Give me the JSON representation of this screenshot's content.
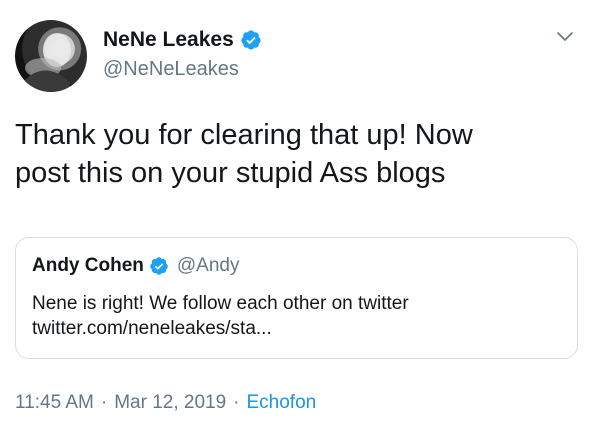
{
  "author": {
    "display_name": "NeNe Leakes",
    "handle": "@NeNeLeakes",
    "verified": true
  },
  "tweet": {
    "text": "Thank you for clearing that up! Now\npost this on your stupid Ass blogs",
    "time": "11:45 AM",
    "separator": "·",
    "date": "Mar 12, 2019",
    "source": "Echofon"
  },
  "quoted_tweet": {
    "display_name": "Andy Cohen",
    "handle": "@Andy",
    "verified": true,
    "text": "Nene is right! We follow each other on twitter\ntwitter.com/neneleakes/sta..."
  },
  "icons": {
    "verified": "verified-badge-icon",
    "menu": "chevron-down-icon"
  },
  "colors": {
    "text": "#14171a",
    "secondary": "#657786",
    "link": "#1b95e0",
    "verified_badge": "#1da1f2",
    "quote_border": "#d5dde3"
  }
}
